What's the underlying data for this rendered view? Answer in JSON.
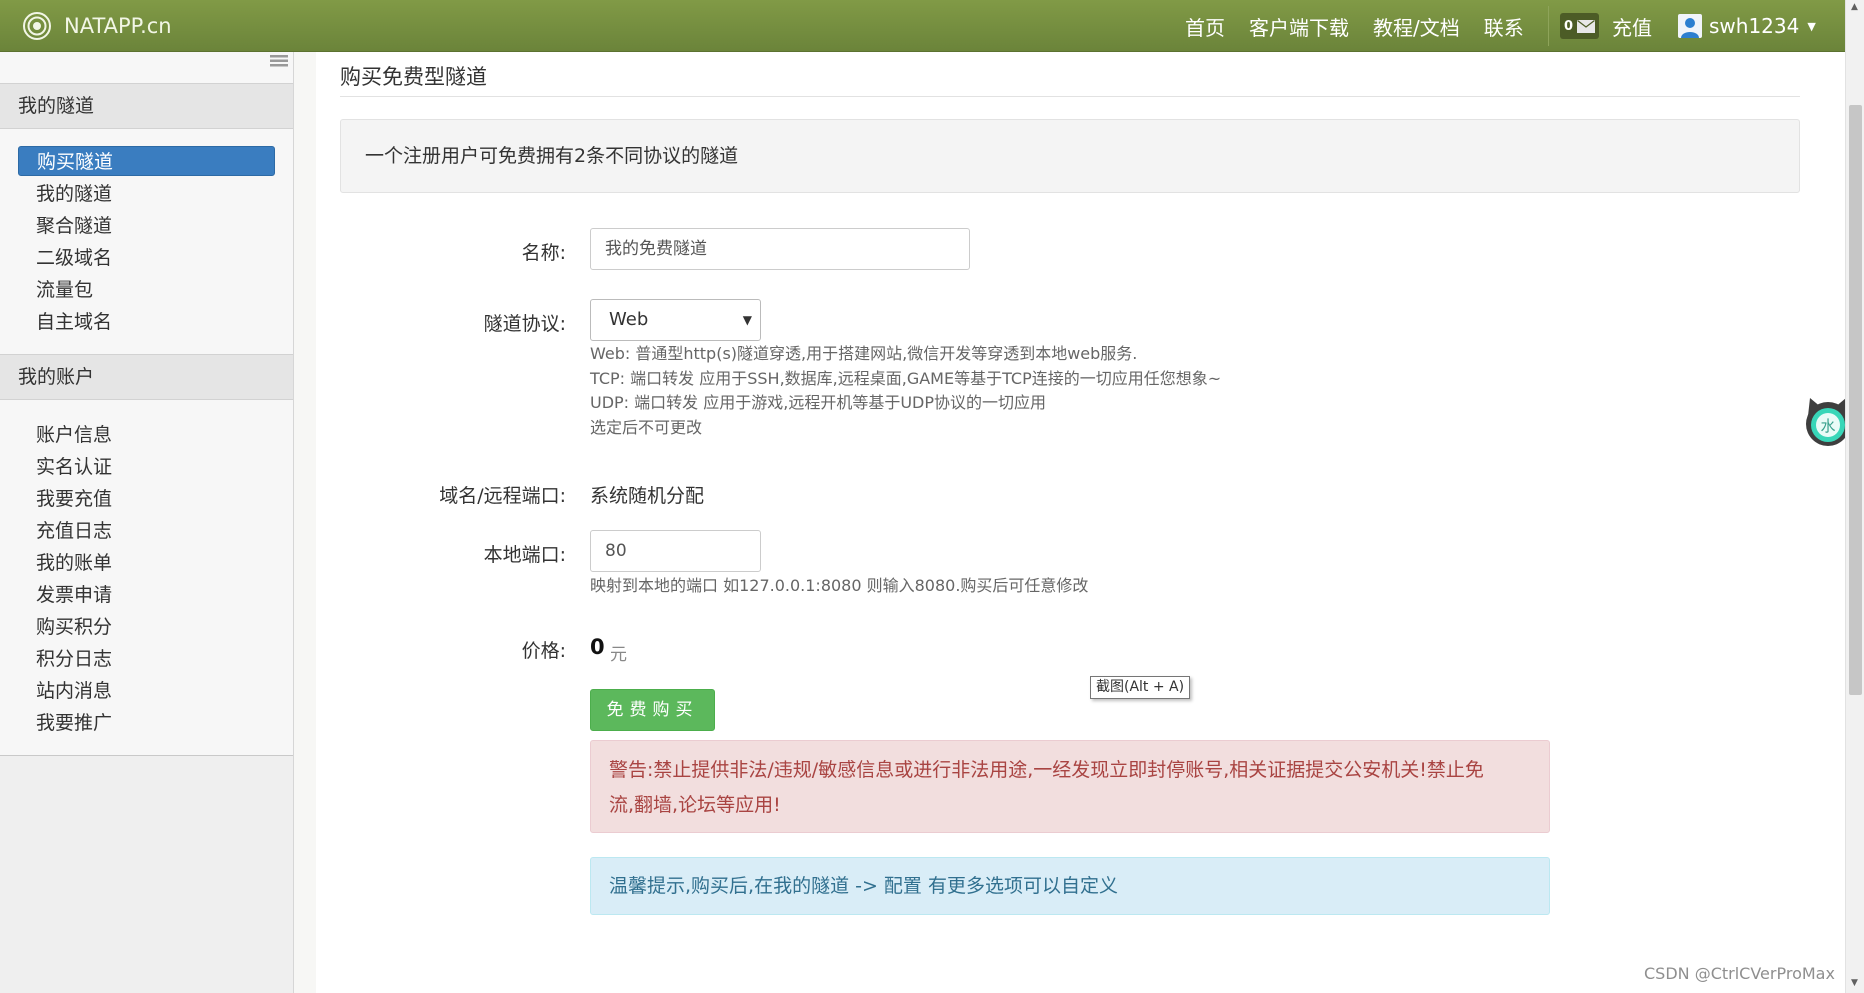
{
  "brand": {
    "name": "NATAPP.cn"
  },
  "nav": {
    "items": [
      "首页",
      "客户端下载",
      "教程/文档",
      "联系"
    ],
    "wallet_count": "0",
    "recharge": "充值",
    "username": "swh1234"
  },
  "sidebar": {
    "section1_title": "我的隧道",
    "section1_items": [
      "购买隧道",
      "我的隧道",
      "聚合隧道",
      "二级域名",
      "流量包",
      "自主域名"
    ],
    "section2_title": "我的账户",
    "section2_items": [
      "账户信息",
      "实名认证",
      "我要充值",
      "充值日志",
      "我的账单",
      "发票申请",
      "购买积分",
      "积分日志",
      "站内消息",
      "我要推广"
    ]
  },
  "main": {
    "title": "购买免费型隧道",
    "notice": "一个注册用户可免费拥有2条不同协议的隧道",
    "name_label": "名称:",
    "name_value": "我的免费隧道",
    "protocol_label": "隧道协议:",
    "protocol_value": "Web",
    "protocol_help": [
      "Web: 普通型http(s)隧道穿透,用于搭建网站,微信开发等穿透到本地web服务.",
      "TCP: 端口转发 应用于SSH,数据库,远程桌面,GAME等基于TCP连接的一切应用任您想象~",
      "UDP: 端口转发 应用于游戏,远程开机等基于UDP协议的一切应用",
      "选定后不可更改"
    ],
    "domain_label": "域名/远程端口:",
    "domain_value": "系统随机分配",
    "port_label": "本地端口:",
    "port_value": "80",
    "port_help": "映射到本地的端口 如127.0.0.1:8080 则输入8080.购买后可任意修改",
    "price_label": "价格:",
    "price_value": "0",
    "price_unit": "元",
    "buy_button": "免费购买",
    "warning_line1": "警告:禁止提供非法/违规/敏感信息或进行非法用途,一经发现立即封停账号,相关证据提交公安机关!禁止免",
    "warning_line2": "流,翻墙,论坛等应用!",
    "tip": "温馨提示,购买后,在我的隧道 -> 配置 有更多选项可以自定义"
  },
  "tooltip": "截图(Alt + A)",
  "watermark": "CSDN @CtrlCVerProMax",
  "colors": {
    "topbar": "#76913f",
    "active": "#3a7dc0",
    "success": "#5cb85c",
    "danger_bg": "#f2dede",
    "info_bg": "#d9edf7"
  }
}
